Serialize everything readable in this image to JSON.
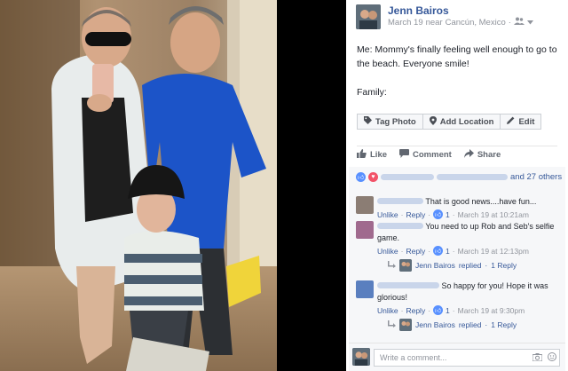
{
  "post": {
    "author": "Jenn Bairos",
    "date": "March 19",
    "location_prefix": "near",
    "location": "Cancún, Mexico",
    "audience_icon": "friends-icon",
    "text_line1": "Me: Mommy's finally feeling well enough to go to the beach. Everyone smile!",
    "text_line2": "Family:"
  },
  "tag_buttons": {
    "tag_photo": "Tag Photo",
    "add_location": "Add Location",
    "edit": "Edit"
  },
  "actions": {
    "like": "Like",
    "comment": "Comment",
    "share": "Share"
  },
  "reactions": {
    "others": "and 27 others"
  },
  "comments": [
    {
      "text": "That is good news....have fun...",
      "unlike": "Unlike",
      "reply": "Reply",
      "likes": "1",
      "time": "March 19 at 10:21am"
    },
    {
      "text": "You need to up Rob and Seb's selfie game.",
      "unlike": "Unlike",
      "reply": "Reply",
      "likes": "1",
      "time": "March 19 at 12:13pm",
      "replied_by": "Jenn Bairos",
      "replied_label": "replied",
      "reply_count": "1 Reply"
    },
    {
      "text": "So happy for you! Hope it was glorious!",
      "unlike": "Unlike",
      "reply": "Reply",
      "likes": "1",
      "time": "March 19 at 9:30pm",
      "replied_by": "Jenn Bairos",
      "replied_label": "replied",
      "reply_count": "1 Reply"
    }
  ],
  "composer": {
    "placeholder": "Write a comment..."
  },
  "colors": {
    "link": "#365899",
    "like_blue": "#5890ff",
    "love_red": "#f25268"
  }
}
